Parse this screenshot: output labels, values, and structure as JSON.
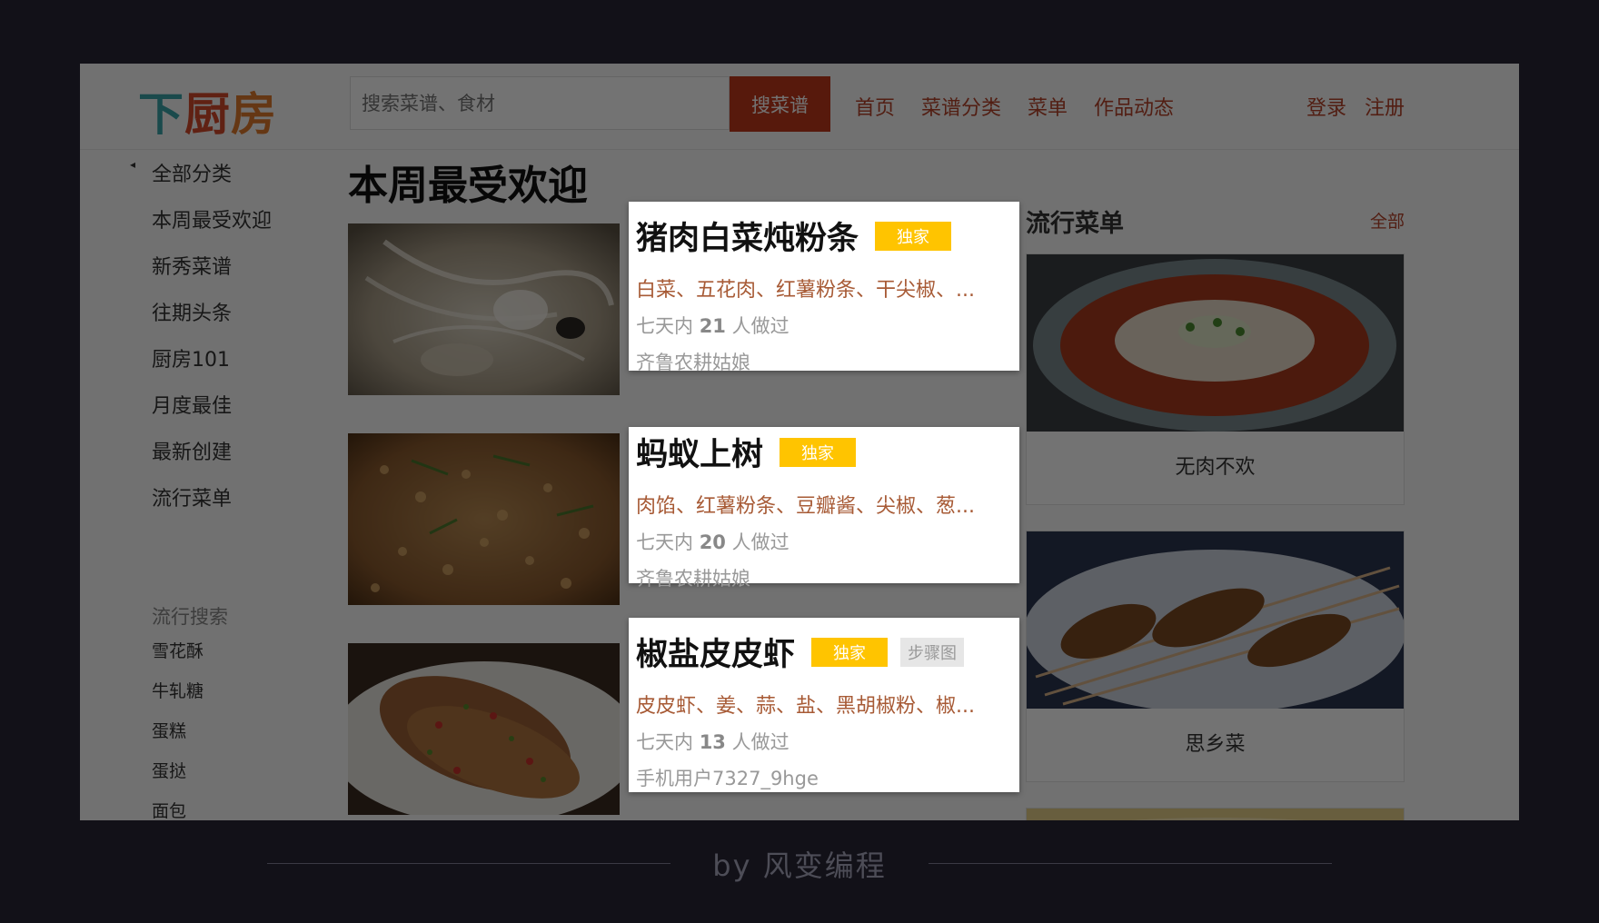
{
  "header": {
    "logo": [
      "下",
      "厨",
      "房"
    ],
    "search_placeholder": "搜索菜谱、食材",
    "search_button": "搜菜谱",
    "nav": [
      "首页",
      "菜谱分类",
      "菜单",
      "作品动态"
    ],
    "login": "登录",
    "register": "注册"
  },
  "sidebar": {
    "items": [
      "全部分类",
      "本周最受欢迎",
      "新秀菜谱",
      "往期头条",
      "厨房101",
      "月度最佳",
      "最新创建",
      "流行菜单"
    ],
    "trend_title": "流行搜索",
    "trend_items": [
      "雪花酥",
      "牛轧糖",
      "蛋糕",
      "蛋挞",
      "面包"
    ]
  },
  "main": {
    "title": "本周最受欢迎",
    "recipes": [
      {
        "title": "猪肉白菜炖粉条",
        "badge": "独家",
        "ingredients": "白菜、五花肉、红薯粉条、干尖椒、...",
        "stats_prefix": "七天内",
        "count": "21",
        "stats_suffix": "人做过",
        "author": "齐鲁农耕姑娘"
      },
      {
        "title": "蚂蚁上树",
        "badge": "独家",
        "ingredients": "肉馅、红薯粉条、豆瓣酱、尖椒、葱...",
        "stats_prefix": "七天内",
        "count": "20",
        "stats_suffix": "人做过",
        "author": "齐鲁农耕姑娘"
      },
      {
        "title": "椒盐皮皮虾",
        "badge": "独家",
        "badge2": "步骤图",
        "ingredients": "皮皮虾、姜、蒜、盐、黑胡椒粉、椒...",
        "stats_prefix": "七天内",
        "count": "13",
        "stats_suffix": "人做过",
        "author": "手机用户7327_9hge"
      }
    ]
  },
  "popular_menus": {
    "title": "流行菜单",
    "all_link": "全部",
    "items": [
      "无肉不欢",
      "思乡菜"
    ]
  },
  "footer": {
    "text": "by 风变编程"
  },
  "colors": {
    "brand_red": "#c1391b",
    "link": "#b5442a",
    "badge_yellow": "#ffc400",
    "background": "#121118"
  }
}
